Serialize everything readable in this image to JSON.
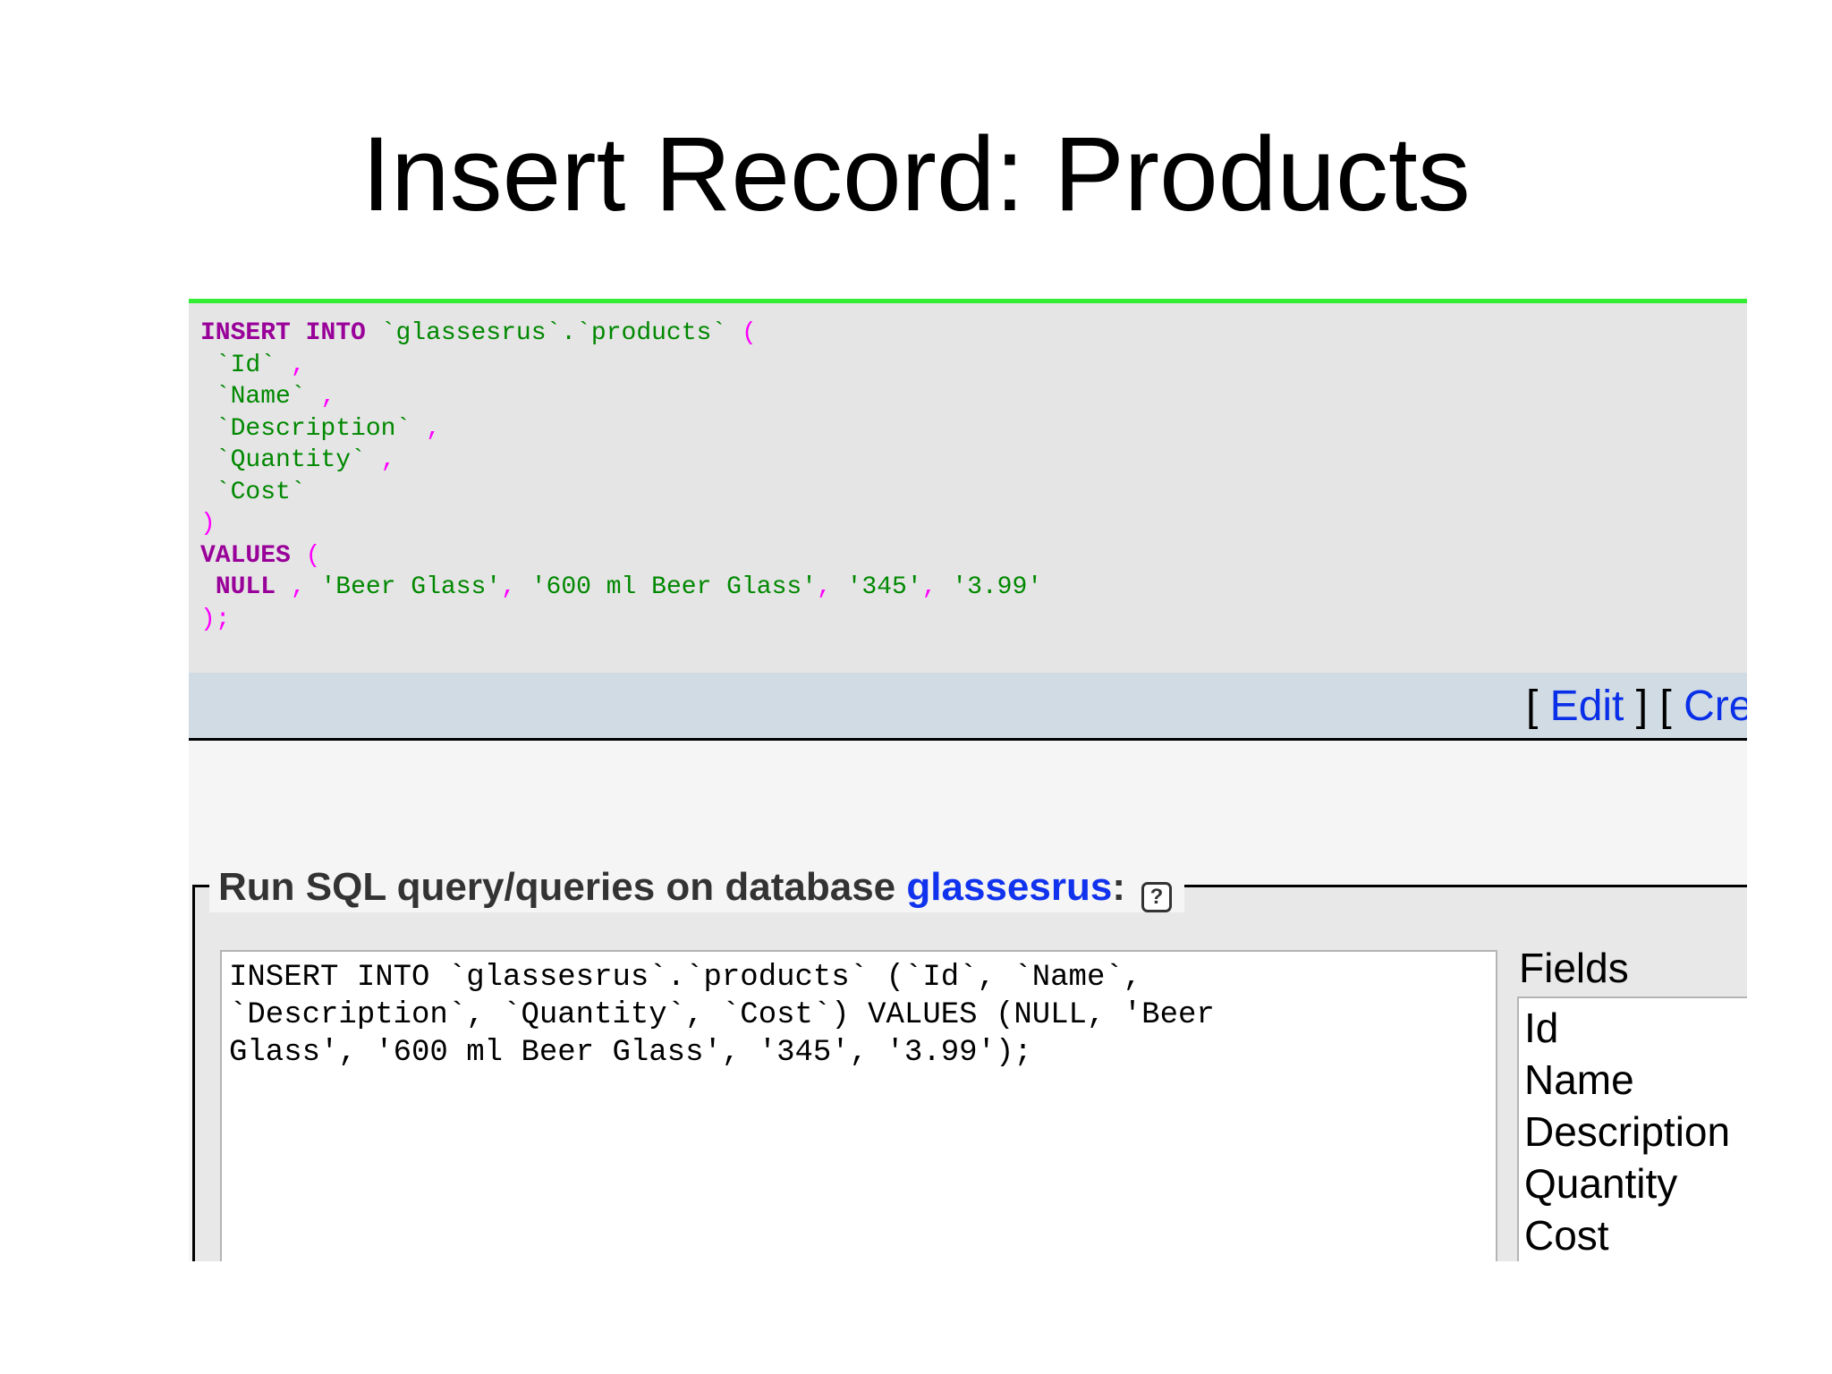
{
  "slide": {
    "title": "Insert Record: Products"
  },
  "sql_preview": {
    "line1": {
      "kw1": "INSERT",
      "kw2": "INTO",
      "table": "`glassesrus`.`products`",
      "paren": "("
    },
    "columns": [
      {
        "name": "`Id`",
        "sep": ","
      },
      {
        "name": "`Name`",
        "sep": ","
      },
      {
        "name": "`Description`",
        "sep": ","
      },
      {
        "name": "`Quantity`",
        "sep": ","
      },
      {
        "name": "`Cost`",
        "sep": ""
      }
    ],
    "close_paren": ")",
    "values_kw": "VALUES",
    "values_paren": "(",
    "values": {
      "null_kw": "NULL",
      "v1": "'Beer Glass'",
      "v2": "'600 ml Beer Glass'",
      "v3": "'345'",
      "v4": "'3.99'"
    },
    "end": ");"
  },
  "actions": {
    "edit_label": "Edit",
    "create_label": "Cre"
  },
  "query_box": {
    "legend_prefix": "Run SQL query/queries on database ",
    "database": "glassesrus",
    "legend_suffix": ":",
    "help_glyph": "?",
    "query_text": "INSERT INTO `glassesrus`.`products` (`Id`, `Name`,\n`Description`, `Quantity`, `Cost`) VALUES (NULL, 'Beer\nGlass', '600 ml Beer Glass', '345', '3.99');",
    "fields_label": "Fields",
    "fields": [
      "Id",
      "Name",
      "Description",
      "Quantity",
      "Cost"
    ]
  }
}
